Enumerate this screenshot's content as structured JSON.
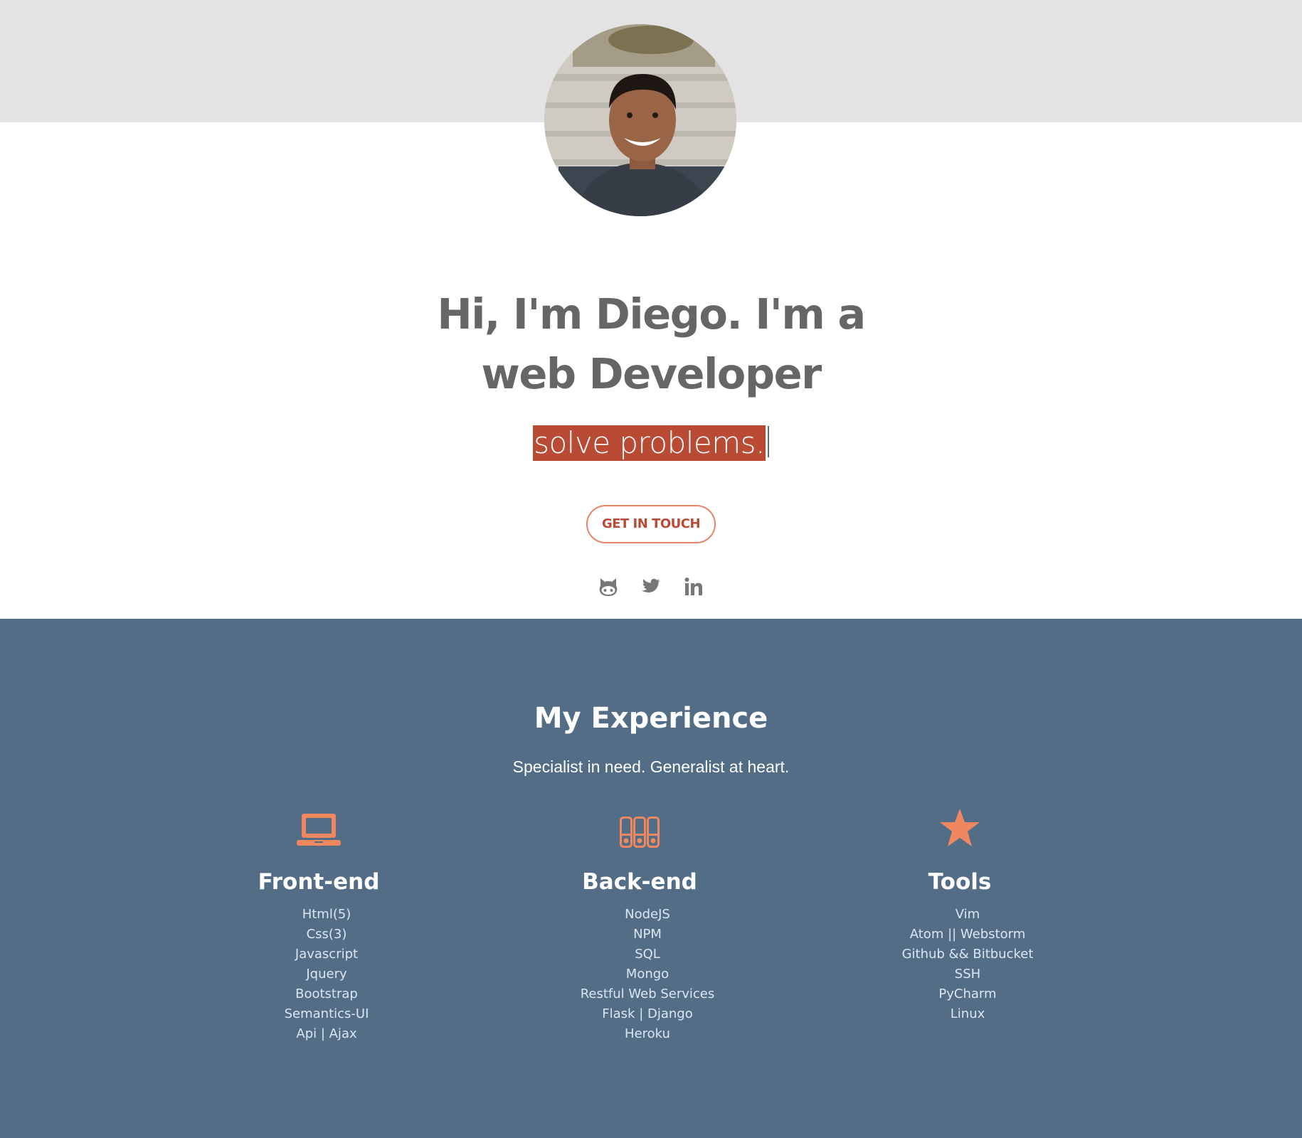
{
  "hero": {
    "headline": "Hi, I'm Diego. I'm a web Developer",
    "typed_text": "solve problems.",
    "cta_label": "GET IN TOUCH"
  },
  "social": [
    {
      "name": "github-icon"
    },
    {
      "name": "twitter-icon"
    },
    {
      "name": "linkedin-icon"
    }
  ],
  "experience": {
    "title": "My Experience",
    "subtitle": "Specialist in need. Generalist at heart.",
    "columns": [
      {
        "icon": "laptop-icon",
        "title": "Front-end",
        "items": [
          "Html(5)",
          "Css(3)",
          "Javascript",
          "Jquery",
          "Bootstrap",
          "Semantics-UI",
          "Api | Ajax"
        ]
      },
      {
        "icon": "server-icon",
        "title": "Back-end",
        "items": [
          "NodeJS",
          "NPM",
          "SQL",
          "Mongo",
          "Restful Web Services",
          "Flask | Django",
          "Heroku"
        ]
      },
      {
        "icon": "star-icon",
        "title": "Tools",
        "items": [
          "Vim",
          "Atom || Webstorm",
          "Github && Bitbucket",
          "SSH",
          "PyCharm",
          "Linux"
        ]
      }
    ]
  },
  "colors": {
    "accent": "#f0885f",
    "highlight": "#b94a34",
    "experience_bg": "#536d86",
    "top_band": "#e3e3e3",
    "text_gray": "#666666"
  }
}
